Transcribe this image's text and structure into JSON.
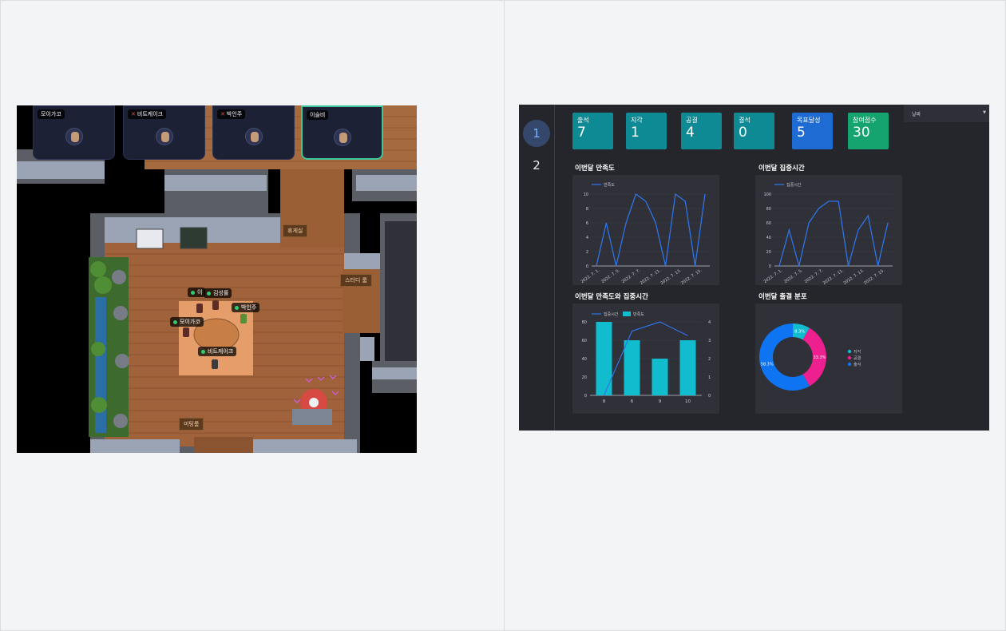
{
  "game": {
    "video_tiles": [
      {
        "name": "모이가코",
        "muted": false,
        "active": false
      },
      {
        "name": "비트케이크",
        "muted": true,
        "active": false
      },
      {
        "name": "박인주",
        "muted": true,
        "active": false
      },
      {
        "name": "이슬비",
        "muted": false,
        "active": true
      }
    ],
    "rooms": {
      "lounge": "휴게실",
      "study": "스터디 룸",
      "meeting": "미팅룸"
    },
    "players": [
      "이",
      "김성률",
      "박인주",
      "모이가코",
      "비트케이크"
    ],
    "colors": {
      "floor": "#a0623a",
      "wall": "#5c5e66",
      "void": "#000000",
      "active_border": "#3fc59a"
    }
  },
  "dashboard": {
    "pages": [
      "1",
      "2"
    ],
    "active_page": "1",
    "date_filter": {
      "label": "날짜"
    },
    "kpis": [
      {
        "label": "출석",
        "value": "7",
        "color": "#0d8a93"
      },
      {
        "label": "지각",
        "value": "1",
        "color": "#0d8a93"
      },
      {
        "label": "공결",
        "value": "4",
        "color": "#0d8a93"
      },
      {
        "label": "결석",
        "value": "0",
        "color": "#0d8a93"
      },
      {
        "label": "목표달성",
        "value": "5",
        "color": "#1d6bd3"
      },
      {
        "label": "참여점수",
        "value": "30",
        "color": "#15a36f"
      }
    ],
    "titles": {
      "satisfaction": "이번달 만족도",
      "focus": "이번달 집중시간",
      "combo": "이번달 만족도와 집중시간",
      "attendance": "이번달 출결 분포"
    }
  },
  "chart_data": [
    {
      "type": "line",
      "title": "이번달 만족도",
      "series": [
        {
          "name": "만족도",
          "values": [
            0,
            6,
            0,
            6,
            10,
            9,
            6,
            0,
            10,
            9,
            0,
            10
          ]
        }
      ],
      "x_tick_labels": [
        "2022. 7. 1.",
        "2022. 7. 5.",
        "2022. 7. 7.",
        "2022. 7. 11.",
        "2022. 7. 13.",
        "2022. 7. 15."
      ],
      "ylim": [
        0,
        10
      ],
      "yticks": [
        0,
        2,
        4,
        6,
        8,
        10
      ],
      "color": "#2f74e8"
    },
    {
      "type": "line",
      "title": "이번달 집중시간",
      "series": [
        {
          "name": "집중시간",
          "values": [
            0,
            50,
            0,
            60,
            80,
            90,
            90,
            0,
            50,
            70,
            0,
            60
          ]
        }
      ],
      "x_tick_labels": [
        "2022. 7. 1.",
        "2022. 7. 5.",
        "2022. 7. 7.",
        "2022. 7. 11.",
        "2022. 7. 13.",
        "2022. 7. 15."
      ],
      "ylim": [
        0,
        100
      ],
      "yticks": [
        0,
        20,
        40,
        60,
        80,
        100
      ],
      "color": "#2f74e8"
    },
    {
      "type": "bar",
      "title": "이번달 만족도와 집중시간",
      "categories": [
        "8",
        "6",
        "9",
        "10"
      ],
      "series": [
        {
          "name": "집중시간",
          "type": "line",
          "axis": "left",
          "values": [
            0,
            70,
            80,
            65
          ],
          "color": "#2f74e8"
        },
        {
          "name": "만족도",
          "type": "bar",
          "axis": "right",
          "values": [
            4,
            3,
            2,
            3
          ],
          "color": "#12bccf"
        }
      ],
      "ylim_left": [
        0,
        80
      ],
      "yticks_left": [
        0,
        20,
        40,
        60,
        80
      ],
      "ylim_right": [
        0,
        4
      ],
      "yticks_right": [
        0,
        1,
        2,
        3,
        4
      ]
    },
    {
      "type": "pie",
      "title": "이번달 출결 분포",
      "donut": true,
      "slices": [
        {
          "label": "지각",
          "value": 8.3,
          "text": "8.3%",
          "color": "#12bccf"
        },
        {
          "label": "공결",
          "value": 33.3,
          "text": "33.3%",
          "color": "#ee1f8f"
        },
        {
          "label": "출석",
          "value": 58.3,
          "text": "58.3%",
          "color": "#0f74f2"
        }
      ],
      "legend": "right"
    }
  ]
}
